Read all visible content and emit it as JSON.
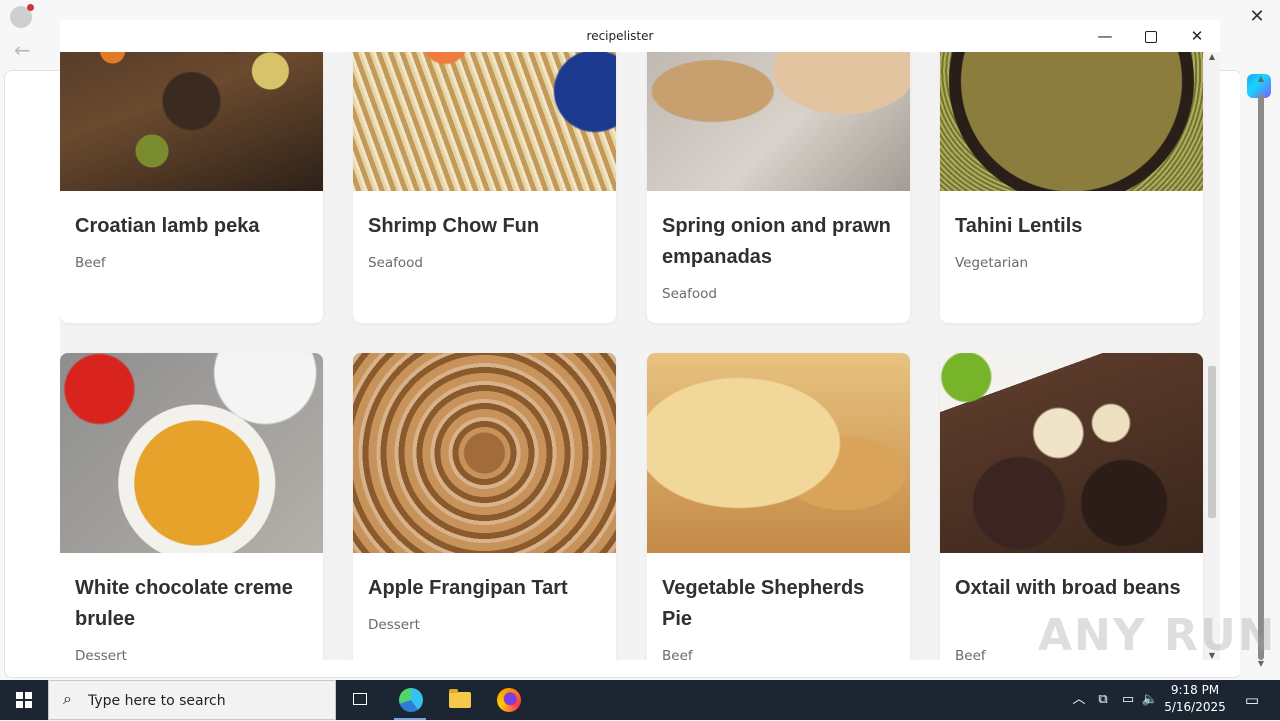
{
  "window": {
    "title": "recipelister",
    "minimize": "—",
    "maximize": "",
    "close": "✕"
  },
  "recipes": [
    {
      "name": "Croatian lamb peka",
      "category": "Beef"
    },
    {
      "name": "Shrimp Chow Fun",
      "category": "Seafood"
    },
    {
      "name": "Spring onion and prawn empanadas",
      "category": "Seafood"
    },
    {
      "name": "Tahini Lentils",
      "category": "Vegetarian"
    },
    {
      "name": "White chocolate creme brulee",
      "category": "Dessert"
    },
    {
      "name": "Apple Frangipan Tart",
      "category": "Dessert"
    },
    {
      "name": "Vegetable Shepherds Pie",
      "category": "Beef"
    },
    {
      "name": "Oxtail with broad beans",
      "category": "Beef"
    }
  ],
  "browser": {
    "close": "✕",
    "back": "←"
  },
  "watermark": "ANY RUN",
  "taskbar": {
    "search_placeholder": "Type here to search",
    "time": "9:18 PM",
    "date": "5/16/2025"
  }
}
